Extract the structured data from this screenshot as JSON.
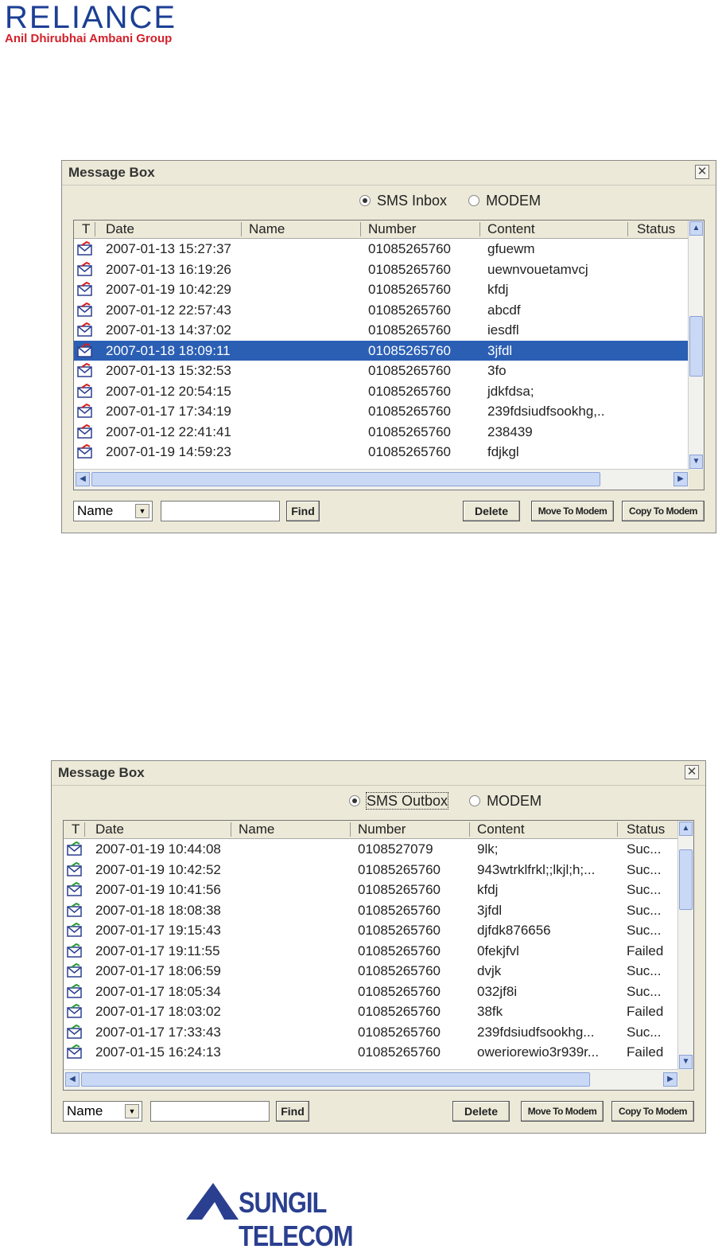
{
  "reliance_logo": {
    "word": "RELIANCE",
    "tagline": "Anil Dhirubhai Ambani Group"
  },
  "sungil_logo": {
    "word": "SUNGIL TELECOM"
  },
  "colors": {
    "selection": "#2b5fb4",
    "window_bg": "#ece9d8",
    "reliance_blue": "#1c3f94",
    "reliance_red": "#d4202a"
  },
  "columns": [
    "T",
    "Date",
    "Name",
    "Number",
    "Content",
    "Status"
  ],
  "window1": {
    "title": "Message Box",
    "close": "✕",
    "radio_inbox": "SMS Inbox",
    "radio_modem": "MODEM",
    "selected_radio": "SMS Inbox",
    "rows": [
      {
        "date": "2007-01-13 15:27:37",
        "name": "",
        "number": "01085265760",
        "content": "gfuewm",
        "status": "",
        "icon": "envelope-read-icon"
      },
      {
        "date": "2007-01-13 16:19:26",
        "name": "",
        "number": "01085265760",
        "content": "uewnvouetamvcj",
        "status": "",
        "icon": "envelope-read-icon"
      },
      {
        "date": "2007-01-19 10:42:29",
        "name": "",
        "number": "01085265760",
        "content": "kfdj",
        "status": "",
        "icon": "envelope-read-icon"
      },
      {
        "date": "2007-01-12 22:57:43",
        "name": "",
        "number": "01085265760",
        "content": "abcdf",
        "status": "",
        "icon": "envelope-read-icon"
      },
      {
        "date": "2007-01-13 14:37:02",
        "name": "",
        "number": "01085265760",
        "content": "iesdfl",
        "status": "",
        "icon": "envelope-read-icon"
      },
      {
        "date": "2007-01-18 18:09:11",
        "name": "",
        "number": "01085265760",
        "content": "3jfdl",
        "status": "",
        "icon": "envelope-read-icon",
        "selected": true
      },
      {
        "date": "2007-01-13 15:32:53",
        "name": "",
        "number": "01085265760",
        "content": "3fo",
        "status": "",
        "icon": "envelope-read-icon"
      },
      {
        "date": "2007-01-12 20:54:15",
        "name": "",
        "number": "01085265760",
        "content": "jdkfdsa;",
        "status": "",
        "icon": "envelope-read-icon"
      },
      {
        "date": "2007-01-17 17:34:19",
        "name": "",
        "number": "01085265760",
        "content": "239fdsiudfsookhg,..",
        "status": "",
        "icon": "envelope-read-icon"
      },
      {
        "date": "2007-01-12 22:41:41",
        "name": "",
        "number": "01085265760",
        "content": "238439",
        "status": "",
        "icon": "envelope-read-icon"
      },
      {
        "date": "2007-01-19 14:59:23",
        "name": "",
        "number": "01085265760",
        "content": "fdjkgl",
        "status": "",
        "icon": "envelope-read-icon"
      }
    ],
    "search_field": "Name",
    "find": "Find",
    "delete": "Delete",
    "move": "Move To Modem",
    "copy": "Copy To Modem"
  },
  "window2": {
    "title": "Message Box",
    "close": "✕",
    "radio_outbox": "SMS Outbox",
    "radio_modem": "MODEM",
    "selected_radio": "SMS Outbox",
    "rows": [
      {
        "date": "2007-01-19 10:44:08",
        "name": "",
        "number": "0108527079",
        "content": "9lk;",
        "status": "Suc...",
        "icon": "envelope-sent-icon"
      },
      {
        "date": "2007-01-19 10:42:52",
        "name": "",
        "number": "01085265760",
        "content": "943wtrklfrkl;;lkjl;h;...",
        "status": "Suc...",
        "icon": "envelope-sent-icon"
      },
      {
        "date": "2007-01-19 10:41:56",
        "name": "",
        "number": "01085265760",
        "content": "kfdj",
        "status": "Suc...",
        "icon": "envelope-sent-icon"
      },
      {
        "date": "2007-01-18 18:08:38",
        "name": "",
        "number": "01085265760",
        "content": "3jfdl",
        "status": "Suc...",
        "icon": "envelope-sent-icon"
      },
      {
        "date": "2007-01-17 19:15:43",
        "name": "",
        "number": "01085265760",
        "content": "djfdk876656",
        "status": "Suc...",
        "icon": "envelope-sent-icon"
      },
      {
        "date": "2007-01-17 19:11:55",
        "name": "",
        "number": "01085265760",
        "content": "0fekjfvl",
        "status": "Failed",
        "icon": "envelope-sent-icon"
      },
      {
        "date": "2007-01-17 18:06:59",
        "name": "",
        "number": "01085265760",
        "content": "dvjk",
        "status": "Suc...",
        "icon": "envelope-sent-icon"
      },
      {
        "date": "2007-01-17 18:05:34",
        "name": "",
        "number": "01085265760",
        "content": "032jf8i",
        "status": "Suc...",
        "icon": "envelope-sent-icon"
      },
      {
        "date": "2007-01-17 18:03:02",
        "name": "",
        "number": "01085265760",
        "content": "38fk",
        "status": "Failed",
        "icon": "envelope-sent-icon"
      },
      {
        "date": "2007-01-17 17:33:43",
        "name": "",
        "number": "01085265760",
        "content": "239fdsiudfsookhg...",
        "status": "Suc...",
        "icon": "envelope-sent-icon"
      },
      {
        "date": "2007-01-15 16:24:13",
        "name": "",
        "number": "01085265760",
        "content": "oweriorewio3r939r...",
        "status": "Failed",
        "icon": "envelope-sent-icon"
      }
    ],
    "search_field": "Name",
    "find": "Find",
    "delete": "Delete",
    "move": "Move To Modem",
    "copy": "Copy To Modem"
  }
}
